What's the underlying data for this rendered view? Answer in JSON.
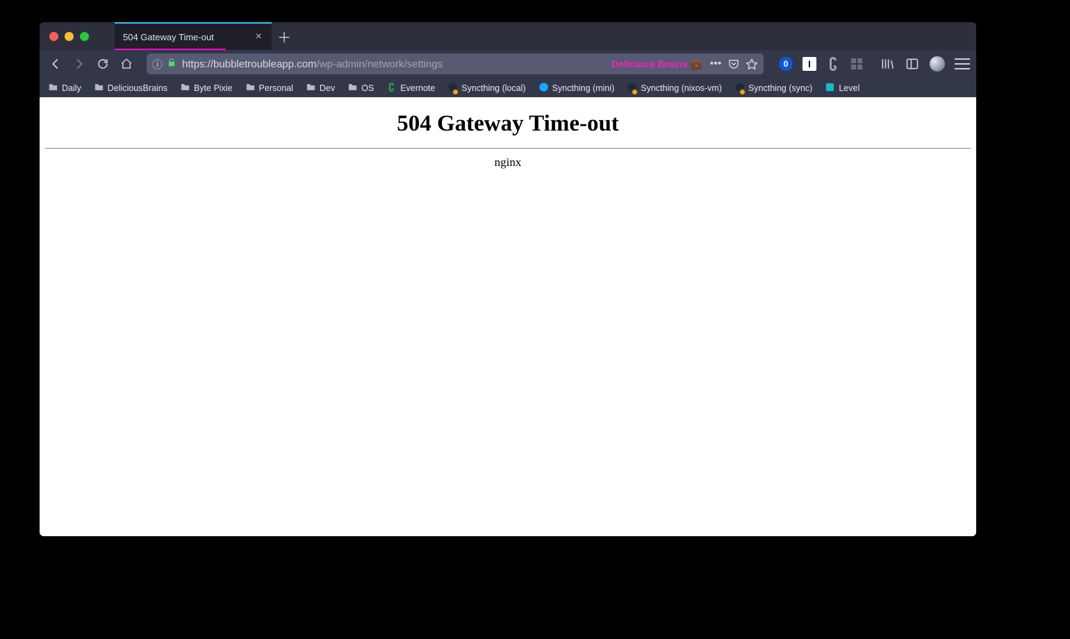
{
  "tab": {
    "title": "504 Gateway Time-out"
  },
  "url": {
    "protocol_host": "https://bubbletroubleapp.com",
    "path": "/wp-admin/network/settings",
    "badge_label": "Delicious Brains"
  },
  "bookmarks": [
    {
      "kind": "folder",
      "label": "Daily"
    },
    {
      "kind": "folder",
      "label": "DeliciousBrains"
    },
    {
      "kind": "folder",
      "label": "Byte Pixie"
    },
    {
      "kind": "folder",
      "label": "Personal"
    },
    {
      "kind": "folder",
      "label": "Dev"
    },
    {
      "kind": "folder",
      "label": "OS"
    },
    {
      "kind": "evernote",
      "label": "Evernote"
    },
    {
      "kind": "sync-dev",
      "label": "Syncthing (local)"
    },
    {
      "kind": "sync",
      "label": "Syncthing (mini)"
    },
    {
      "kind": "sync-dev",
      "label": "Syncthing (nixos-vm)"
    },
    {
      "kind": "sync-dev",
      "label": "Syncthing (sync)"
    },
    {
      "kind": "level",
      "label": "Level"
    }
  ],
  "page": {
    "title": "504 Gateway Time-out",
    "server": "nginx"
  }
}
